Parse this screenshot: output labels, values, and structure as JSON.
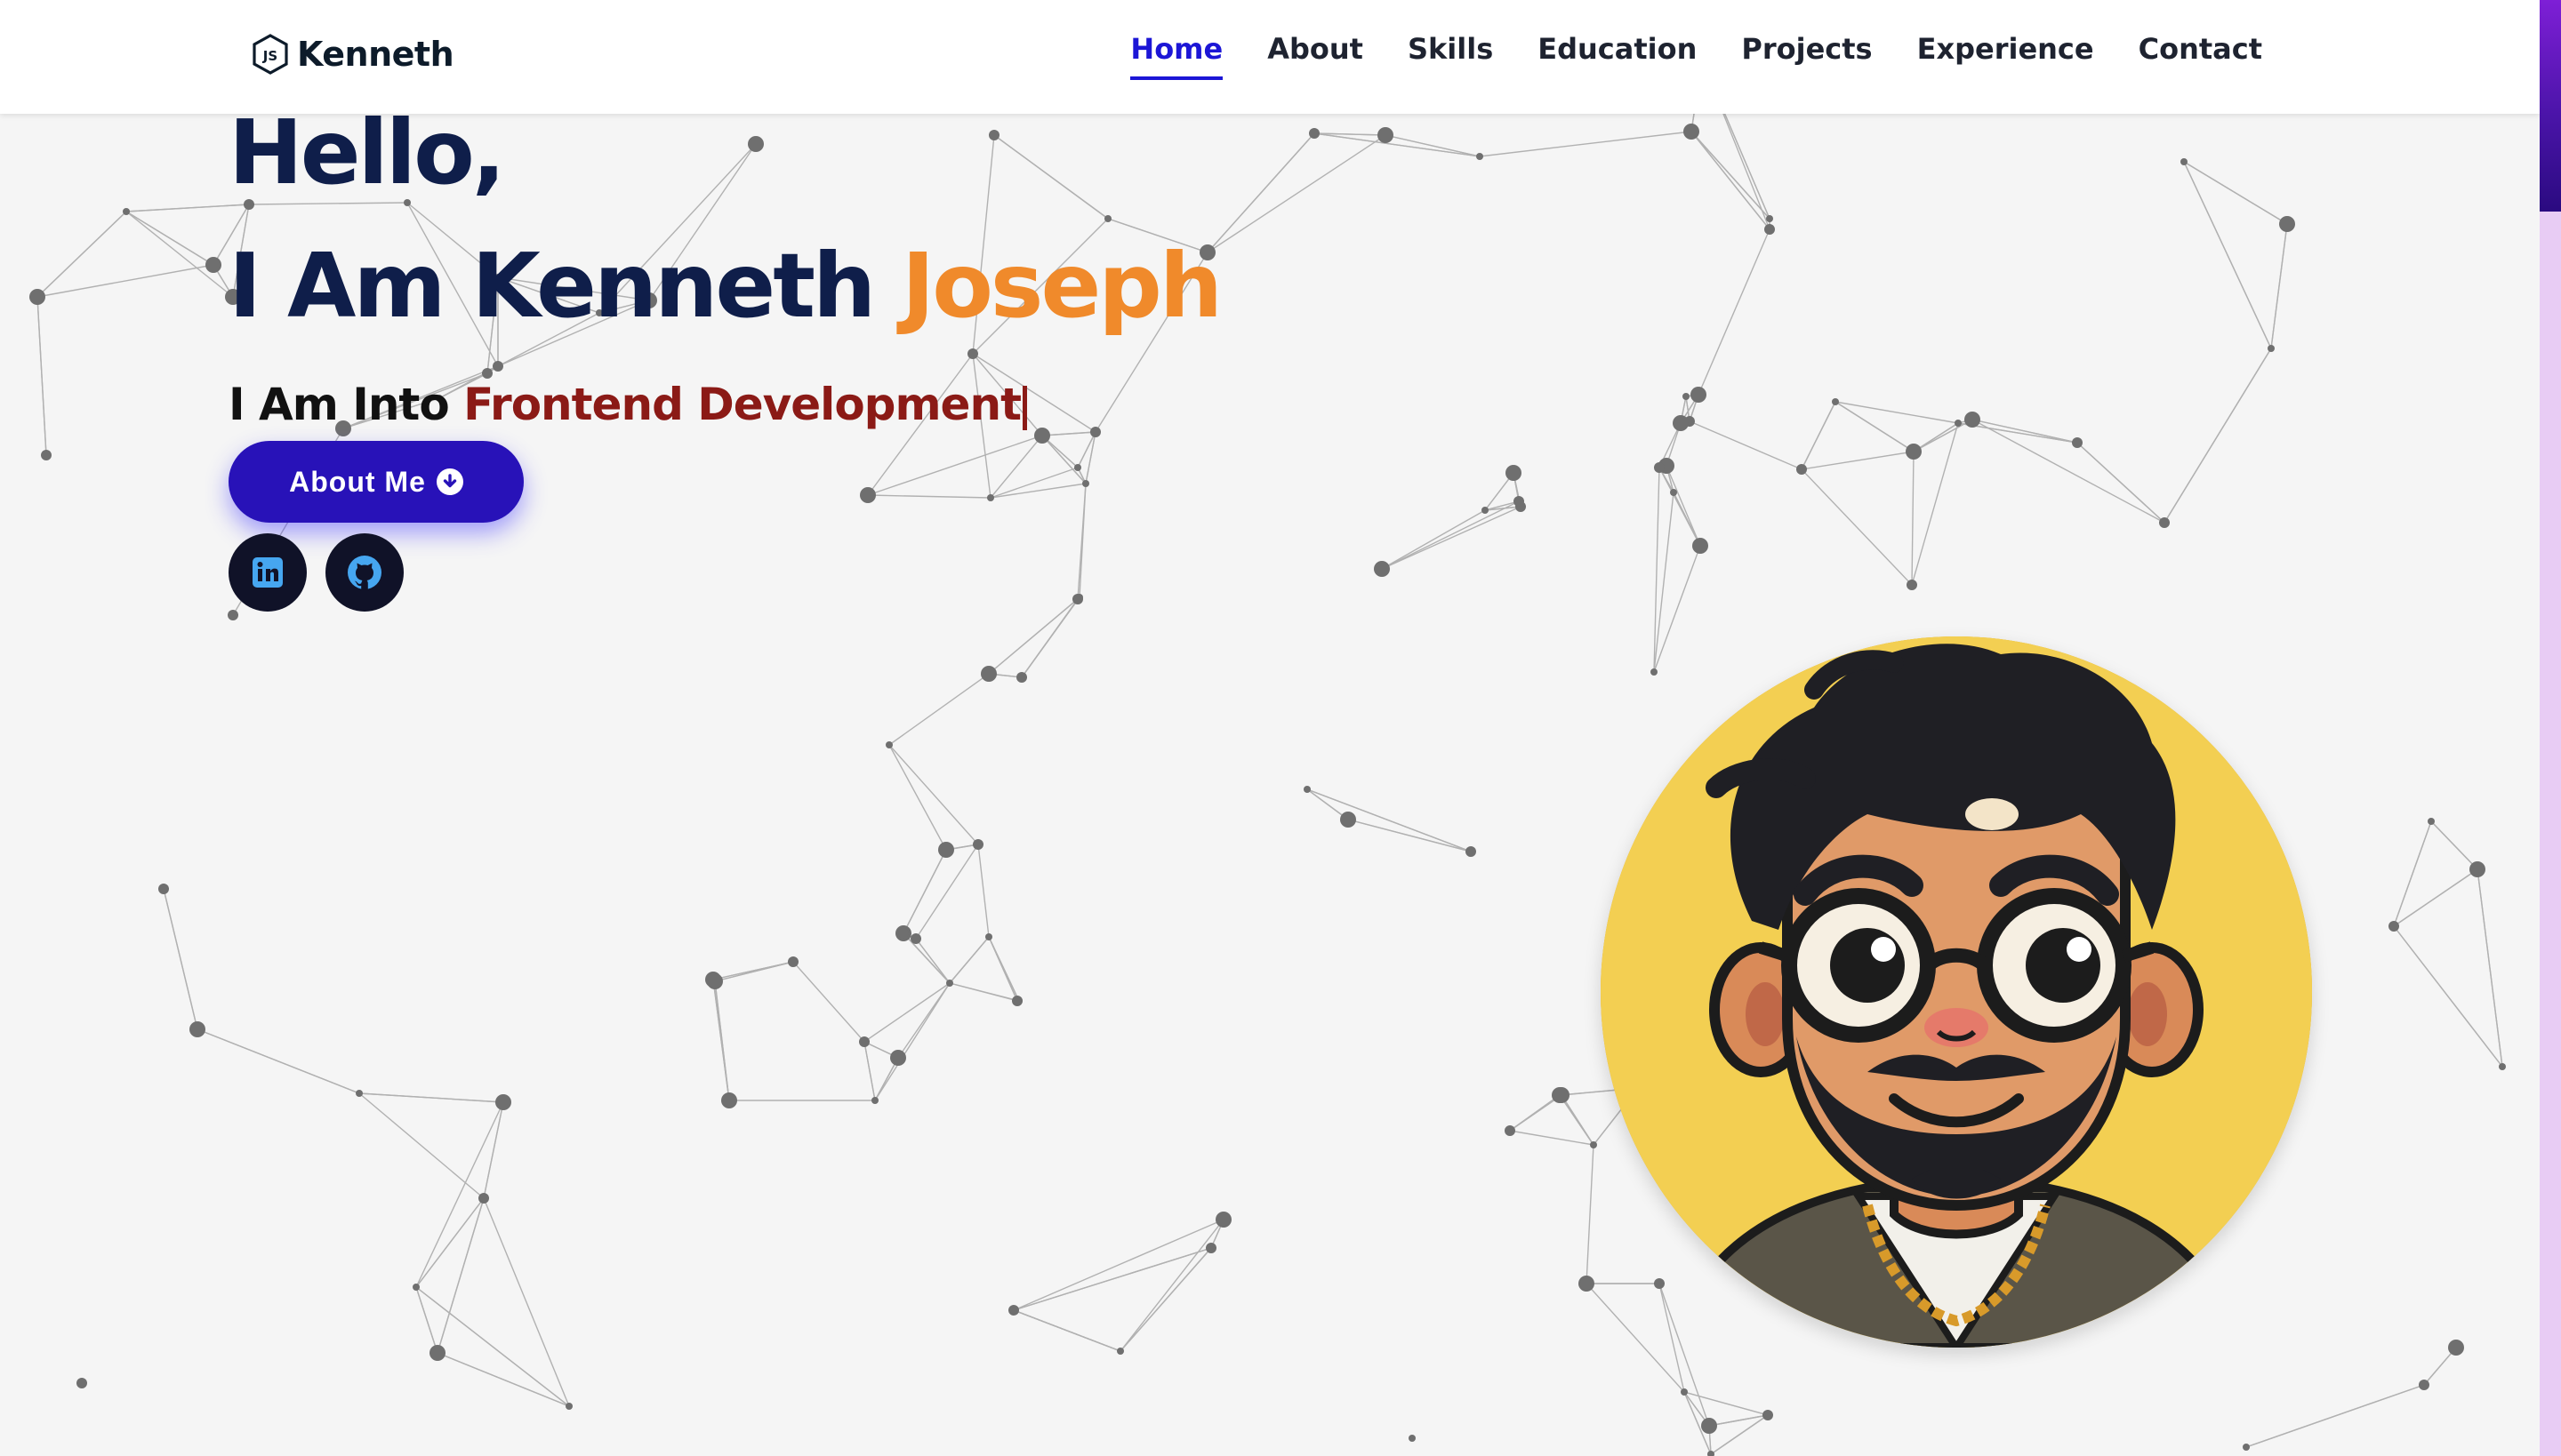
{
  "brand": {
    "name": "Kenneth",
    "icon": "nodejs-icon"
  },
  "nav": {
    "items": [
      {
        "label": "Home",
        "active": true
      },
      {
        "label": "About"
      },
      {
        "label": "Skills"
      },
      {
        "label": "Education"
      },
      {
        "label": "Projects"
      },
      {
        "label": "Experience"
      },
      {
        "label": "Contact"
      }
    ]
  },
  "hero": {
    "greeting": "Hello,",
    "intro": "I Am Kenneth",
    "surname": "Joseph",
    "into_prefix": "I Am Into",
    "role": "Frontend Development",
    "button_label": "About Me",
    "button_icon": "arrow-down-circle-icon"
  },
  "social": [
    {
      "name": "LinkedIn",
      "icon": "linkedin-icon"
    },
    {
      "name": "GitHub",
      "icon": "github-icon"
    }
  ],
  "colors": {
    "accent": "#1c16d6",
    "button": "#2812b8",
    "heading": "#0f1e4a",
    "surname": "#f08a2b",
    "role": "#8b1a16",
    "avatar_bg": "#f3cf52",
    "social_bg": "#101228",
    "social_icon": "#46a6f0"
  }
}
